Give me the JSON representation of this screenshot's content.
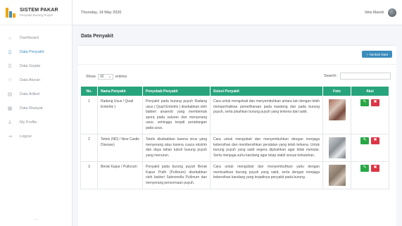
{
  "brand": {
    "title": "SISTEM PAKAR",
    "subtitle": "Penyakit Burung Puyuh"
  },
  "sidebar": {
    "items": [
      {
        "label": "Dashboard",
        "icon": "home-icon"
      },
      {
        "label": "Data Penyakit",
        "icon": "file-icon",
        "active": true
      },
      {
        "label": "Data Gejala",
        "icon": "list-icon"
      },
      {
        "label": "Data Aturan",
        "icon": "rules-icon"
      },
      {
        "label": "Data Artikel",
        "icon": "article-icon"
      },
      {
        "label": "Data Riwayat",
        "icon": "history-icon"
      },
      {
        "label": "My Profile",
        "icon": "user-icon"
      },
      {
        "label": "Logout",
        "icon": "logout-icon"
      }
    ],
    "footer": "—"
  },
  "topbar": {
    "date": "Thursday, 14 May 2020",
    "user": "Idris Maroli"
  },
  "page": {
    "title": "Data Penyakit",
    "add_label": "+ Tambah Data"
  },
  "table_controls": {
    "show_label": "Show",
    "entries_value": "10",
    "entries_label": "entries",
    "search_label": "Search:"
  },
  "table": {
    "headers": [
      "No.",
      "Nama Penyakit",
      "Penyebab Penyakit",
      "Solusi Penyakit",
      "Foto",
      "Aksi"
    ],
    "rows": [
      {
        "no": "1",
        "nama": "Radang Usus / Quail Enteritis )",
        "penyebab": "Penyakit pada burung puyuh Radang usus ( Quail Enteritis ) disebabkan oleh bakteri anaerob yang membentuk spora pada saluran dan menyerang usus, sehingga terjadi peradangan pada usus.",
        "solusi": "Cara untuk mengobati dan menyembuhkan antara lain dengan lebih memperhatikan pemeliharaan pada kandang dan pada burung puyuh, serta pisahkan burung puyuh yang terkena dari sakit."
      },
      {
        "no": "2",
        "nama": "Tetelo (ND) / New Castle Disease)",
        "penyebab": "Tetelo disebabkan karena virus yang menyerang atau karena cuaca ekstrim dan daya tahan tubuh burung puyuh yang menurun.",
        "solusi": "Cara untuk mengobati dan menyembuhkan dengan menjaga kebersihan dan membersihkan peralatan yang telah terkena. Untuk burung puyuh yang sakit segera dipisahkan agar tidak menular. Serta menjaga suhu kandang agar tetap stabil sesuai kebutuhan."
      },
      {
        "no": "3",
        "nama": "Berak Kapur / Pullorum",
        "penyebab": "Penyakit pada burung puyuh Berak Kapur Putih (Pullorum) disebabkan oleh bakteri Salmonella Pullorum dan menyerang pencernaan puyuh.",
        "solusi": "Cara untuk mengobati dan menyembuhkan yaitu dengan memisahkan burung puyuh yang sakit, serta dengan menjaga kebersihan kandang yang terjadinya penyakit pada burung."
      }
    ]
  }
}
